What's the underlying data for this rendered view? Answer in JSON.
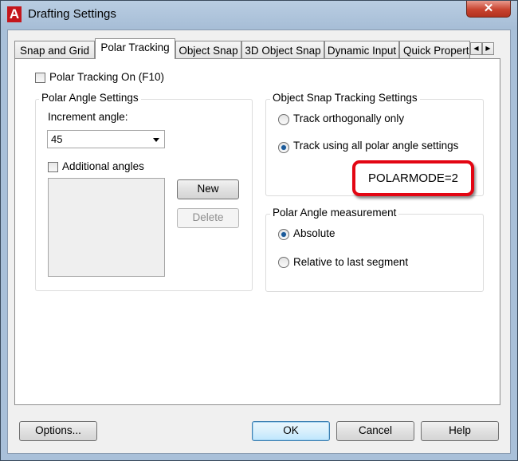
{
  "window": {
    "title": "Drafting Settings",
    "app_icon_letter": "A",
    "close_glyph": "✕"
  },
  "tabs": [
    {
      "label": "Snap and Grid",
      "active": false
    },
    {
      "label": "Polar Tracking",
      "active": true
    },
    {
      "label": "Object Snap",
      "active": false
    },
    {
      "label": "3D Object Snap",
      "active": false
    },
    {
      "label": "Dynamic Input",
      "active": false
    },
    {
      "label": "Quick Propert",
      "active": false
    }
  ],
  "tab_scroll": {
    "left": "◀",
    "right": "▶"
  },
  "polar_tracking_on": {
    "label": "Polar Tracking On (F10)",
    "checked": false
  },
  "polar_angle_settings": {
    "title": "Polar Angle Settings",
    "increment_label": "Increment angle:",
    "increment_value": "45",
    "additional_angles": {
      "label": "Additional angles",
      "checked": false
    },
    "new_button": "New",
    "delete_button": "Delete"
  },
  "object_snap_tracking": {
    "title": "Object Snap Tracking Settings",
    "options": [
      {
        "label": "Track orthogonally only",
        "selected": false
      },
      {
        "label": "Track using all polar angle settings",
        "selected": true
      }
    ]
  },
  "polar_angle_measurement": {
    "title": "Polar Angle measurement",
    "options": [
      {
        "label": "Absolute",
        "selected": true
      },
      {
        "label": "Relative to last segment",
        "selected": false
      }
    ]
  },
  "callout": {
    "text": "POLARMODE=2",
    "border_color": "#e30613"
  },
  "footer": {
    "options_button": "Options...",
    "ok_button": "OK",
    "cancel_button": "Cancel",
    "help_button": "Help"
  }
}
